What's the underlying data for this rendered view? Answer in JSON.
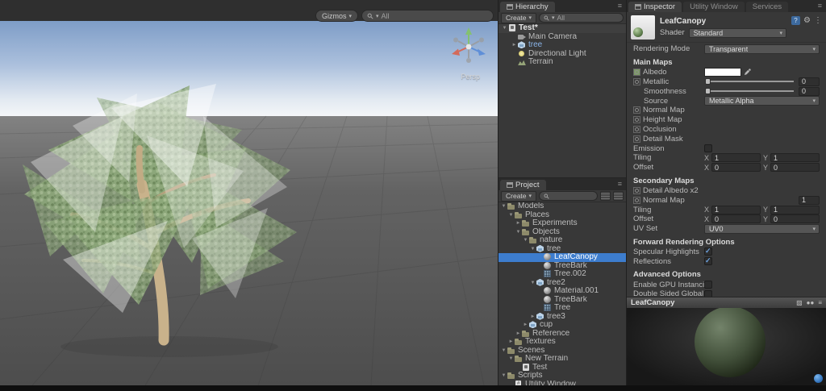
{
  "colors": {
    "selection": "#3d7dce",
    "prefab": "#8ab4e8",
    "check": "#6ca1dd"
  },
  "scene": {
    "toolbar": {
      "gizmos_label": "Gizmos",
      "search_placeholder": "All"
    },
    "gizmo": {
      "persp_label": "Persp"
    }
  },
  "hierarchy": {
    "tab": "Hierarchy",
    "create_label": "Create",
    "search_placeholder": "All",
    "root": {
      "label": "Test*",
      "icon": "scene",
      "arrow": "open"
    },
    "items": [
      {
        "label": "Main Camera",
        "icon": "camera",
        "depth": 1
      },
      {
        "label": "tree",
        "icon": "cube",
        "depth": 1,
        "prefab": true,
        "arrow": "closed"
      },
      {
        "label": "Directional Light",
        "icon": "light",
        "depth": 1
      },
      {
        "label": "Terrain",
        "icon": "terrain",
        "depth": 1
      }
    ]
  },
  "project": {
    "tab": "Project",
    "create_label": "Create",
    "search_placeholder": "",
    "items": [
      {
        "label": "Models",
        "icon": "folder",
        "depth": 0,
        "arrow": "open"
      },
      {
        "label": "Places",
        "icon": "folder",
        "depth": 1,
        "arrow": "open"
      },
      {
        "label": "Experiments",
        "icon": "folder",
        "depth": 2,
        "arrow": "closed"
      },
      {
        "label": "Objects",
        "icon": "folder",
        "depth": 2,
        "arrow": "open"
      },
      {
        "label": "nature",
        "icon": "folder",
        "depth": 3,
        "arrow": "open"
      },
      {
        "label": "tree",
        "icon": "model",
        "depth": 4,
        "arrow": "open"
      },
      {
        "label": "LeafCanopy",
        "icon": "material",
        "depth": 5,
        "selected": true
      },
      {
        "label": "TreeBark",
        "icon": "material",
        "depth": 5
      },
      {
        "label": "Tree.002",
        "icon": "mesh",
        "depth": 5
      },
      {
        "label": "tree2",
        "icon": "model",
        "depth": 4,
        "arrow": "open"
      },
      {
        "label": "Material.001",
        "icon": "material",
        "depth": 5
      },
      {
        "label": "TreeBark",
        "icon": "material",
        "depth": 5
      },
      {
        "label": "Tree",
        "icon": "mesh",
        "depth": 5
      },
      {
        "label": "tree3",
        "icon": "model",
        "depth": 4,
        "arrow": "closed"
      },
      {
        "label": "cup",
        "icon": "model",
        "depth": 3,
        "arrow": "closed"
      },
      {
        "label": "Reference",
        "icon": "folder",
        "depth": 2,
        "arrow": "closed"
      },
      {
        "label": "Textures",
        "icon": "folder",
        "depth": 1,
        "arrow": "closed"
      },
      {
        "label": "Scenes",
        "icon": "folder",
        "depth": 0,
        "arrow": "open"
      },
      {
        "label": "New Terrain",
        "icon": "folder",
        "depth": 1,
        "arrow": "open"
      },
      {
        "label": "Test",
        "icon": "scene",
        "depth": 2
      },
      {
        "label": "Scripts",
        "icon": "folder",
        "depth": 0,
        "arrow": "open"
      },
      {
        "label": "Utility Window",
        "icon": "script",
        "depth": 1
      }
    ]
  },
  "inspector": {
    "tabs": [
      {
        "label": "Inspector",
        "active": true
      },
      {
        "label": "Utility Window"
      },
      {
        "label": "Services"
      }
    ],
    "material": {
      "name": "LeafCanopy",
      "shader_label": "Shader",
      "shader": "Standard"
    },
    "rows": [
      {
        "type": "dropdown",
        "label": "Rendering Mode",
        "value": "Transparent"
      },
      {
        "type": "section",
        "label": "Main Maps"
      },
      {
        "type": "color",
        "label": "Albedo",
        "tex": true,
        "thumb": "green"
      },
      {
        "type": "slider",
        "label": "Metallic",
        "tex": true,
        "value": "0"
      },
      {
        "type": "slider",
        "label": "Smoothness",
        "indent": 1,
        "value": "0"
      },
      {
        "type": "dropdown",
        "label": "Source",
        "indent": 1,
        "value": "Metallic Alpha"
      },
      {
        "type": "label",
        "label": "Normal Map",
        "tex": true
      },
      {
        "type": "label",
        "label": "Height Map",
        "tex": true
      },
      {
        "type": "label",
        "label": "Occlusion",
        "tex": true
      },
      {
        "type": "label",
        "label": "Detail Mask",
        "tex": true
      },
      {
        "type": "checkbox",
        "label": "Emission",
        "checked": false
      },
      {
        "type": "xy",
        "label": "Tiling",
        "x": "1",
        "y": "1"
      },
      {
        "type": "xy",
        "label": "Offset",
        "x": "0",
        "y": "0"
      },
      {
        "type": "section",
        "label": "Secondary Maps"
      },
      {
        "type": "label",
        "label": "Detail Albedo x2",
        "tex": true
      },
      {
        "type": "field",
        "label": "Normal Map",
        "tex": true,
        "value": "1"
      },
      {
        "type": "xy",
        "label": "Tiling",
        "x": "1",
        "y": "1"
      },
      {
        "type": "xy",
        "label": "Offset",
        "x": "0",
        "y": "0"
      },
      {
        "type": "dropdown",
        "label": "UV Set",
        "value": "UV0"
      },
      {
        "type": "section",
        "label": "Forward Rendering Options"
      },
      {
        "type": "checkbox",
        "label": "Specular Highlights",
        "checked": true
      },
      {
        "type": "checkbox",
        "label": "Reflections",
        "checked": true
      },
      {
        "type": "section",
        "label": "Advanced Options"
      },
      {
        "type": "checkbox",
        "label": "Enable GPU Instancing",
        "checked": false
      },
      {
        "type": "checkbox",
        "label": "Double Sided Global Il",
        "checked": false
      }
    ],
    "preview": {
      "title": "LeafCanopy"
    }
  }
}
